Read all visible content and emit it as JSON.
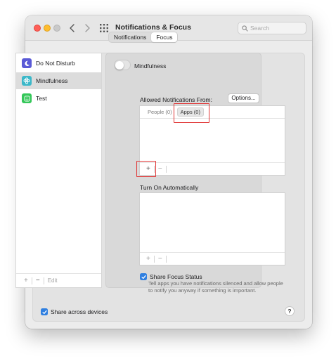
{
  "window": {
    "title": "Notifications & Focus",
    "search_placeholder": "Search"
  },
  "tabs": [
    {
      "label": "Notifications",
      "active": false
    },
    {
      "label": "Focus",
      "active": true
    }
  ],
  "sidebar": {
    "items": [
      {
        "label": "Do Not Disturb",
        "icon": "moon-icon",
        "color": "#5a5ad6",
        "selected": false
      },
      {
        "label": "Mindfulness",
        "icon": "flower-icon",
        "color": "#3bb8c9",
        "selected": true
      },
      {
        "label": "Test",
        "icon": "face-icon",
        "color": "#34c759",
        "selected": false
      }
    ],
    "add_label": "+",
    "remove_label": "−",
    "edit_label": "Edit"
  },
  "detail": {
    "focus_name": "Mindfulness",
    "toggle_on": false,
    "allowed_label": "Allowed Notifications From:",
    "options_label": "Options...",
    "people_tab": "People (0)",
    "apps_tab": "Apps (0)",
    "add_label": "+",
    "remove_label": "−",
    "turn_on_label": "Turn On Automatically",
    "share_status_label": "Share Focus Status",
    "share_status_checked": true,
    "share_status_desc": "Tell apps you have notifications silenced and allow people to notify you anyway if something is important."
  },
  "footer": {
    "share_devices_label": "Share across devices",
    "share_devices_checked": true,
    "help_label": "?"
  },
  "colors": {
    "accent": "#2f7fe0",
    "highlight": "#e03535"
  }
}
